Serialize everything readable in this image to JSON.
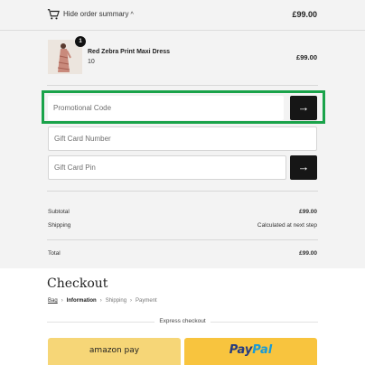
{
  "order_summary": {
    "toggle_label": "Hide order summary",
    "total": "£99.00"
  },
  "product": {
    "quantity_badge": "1",
    "name": "Red Zebra Print Maxi Dress",
    "size": "10",
    "price": "£99.00"
  },
  "fields": {
    "promo_placeholder": "Promotional Code",
    "gift_card_number_placeholder": "Gift Card Number",
    "gift_card_pin_placeholder": "Gift Card Pin"
  },
  "totals": {
    "subtotal_label": "Subtotal",
    "subtotal_value": "£99.00",
    "shipping_label": "Shipping",
    "shipping_value": "Calculated at next step",
    "total_label": "Total",
    "total_value": "£99.00"
  },
  "checkout": {
    "title": "Checkout",
    "breadcrumb": [
      "Bag",
      "Information",
      "Shipping",
      "Payment"
    ],
    "express_label": "Express checkout",
    "amazon_label": "amazon pay",
    "paypal_label_1": "Pay",
    "paypal_label_2": "Pal"
  },
  "colors": {
    "highlight": "#1aa34a",
    "amazon_button": "#f6d677",
    "paypal_button": "#f8c43e",
    "paypal_dark": "#253b80",
    "paypal_light": "#179bd7"
  }
}
